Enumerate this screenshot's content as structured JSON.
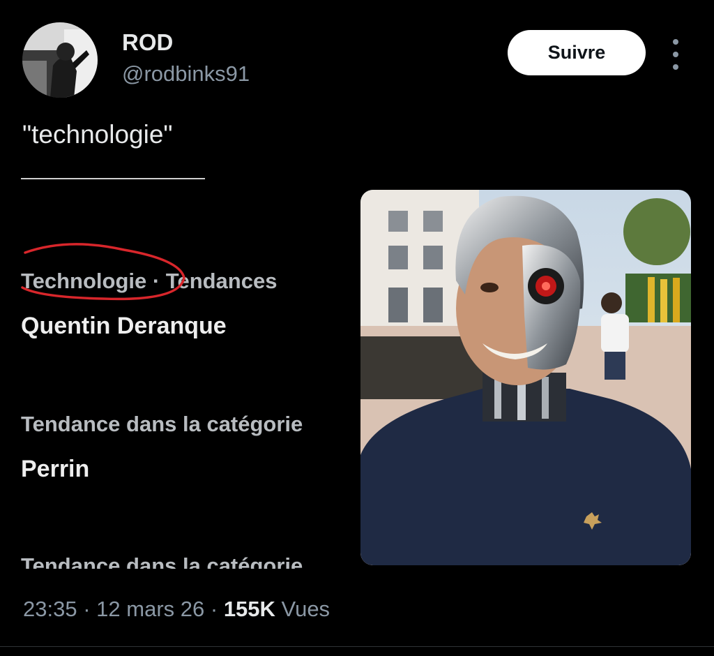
{
  "author": {
    "display_name": "ROD",
    "handle": "@rodbinks91"
  },
  "follow_button": {
    "label": "Suivre"
  },
  "more_icon": "more-vertical-icon",
  "tweet": {
    "text": "\"technologie\""
  },
  "embedded_screenshot": {
    "trends": [
      {
        "meta": "Technologie · Tendances",
        "name": "Quentin Deranque"
      },
      {
        "meta": "Tendance dans la catégorie",
        "name": "Perrin"
      }
    ],
    "cut_off_bottom": "Tendance dans la catégorie",
    "annotation_color": "#d8262b"
  },
  "footer": {
    "time": "23:35",
    "separator": "·",
    "date": "12 mars 26",
    "views_count": "155K",
    "views_label": "Vues"
  },
  "colors": {
    "background": "#000000",
    "text_primary": "#e7e9ea",
    "text_secondary": "#8b98a5",
    "button_bg": "#ffffff"
  }
}
